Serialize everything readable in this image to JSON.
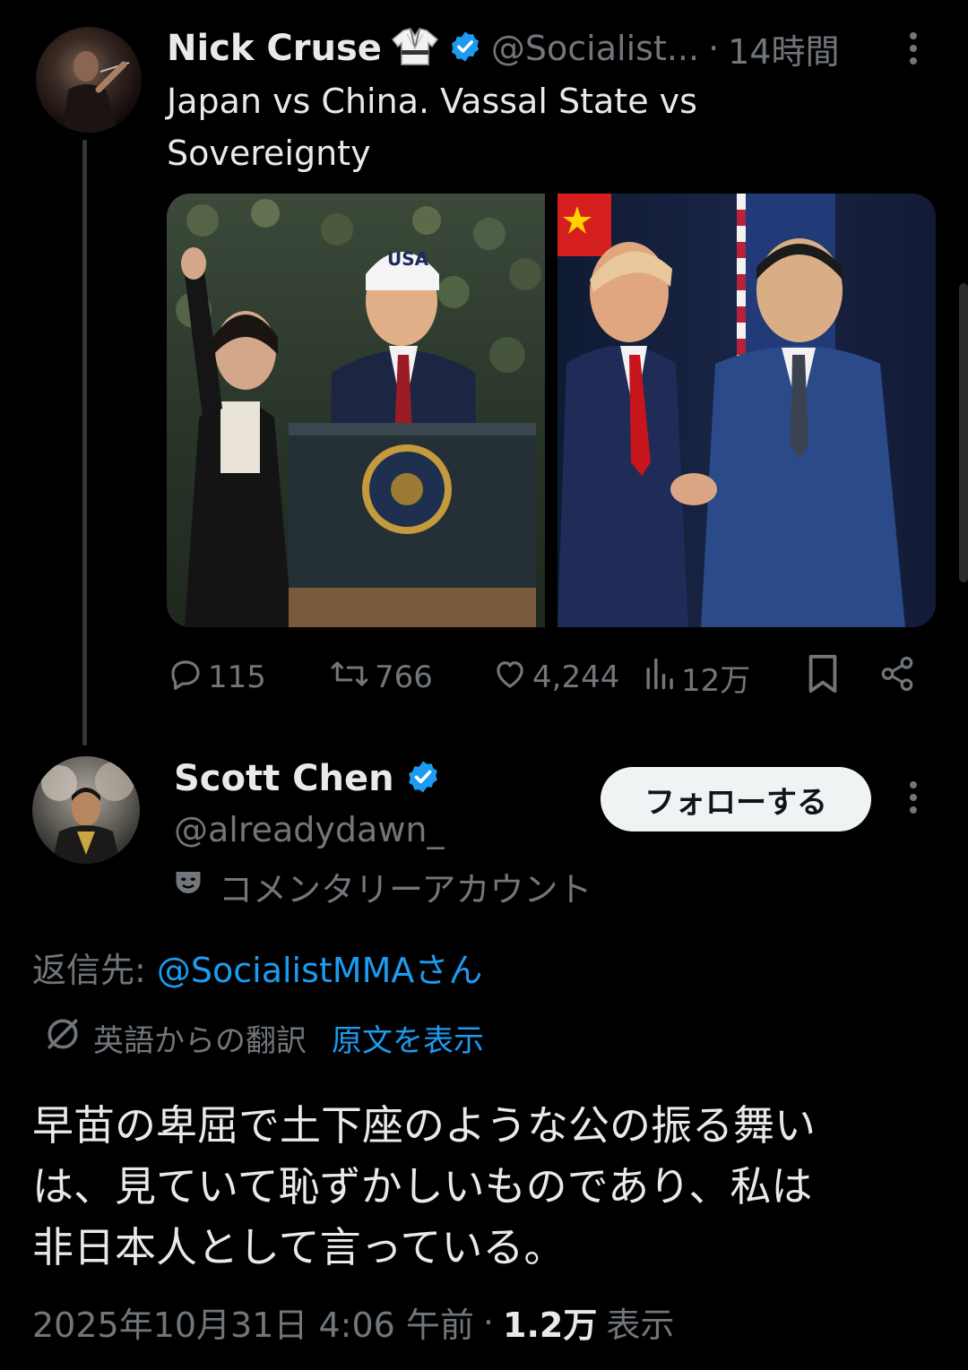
{
  "parent_tweet": {
    "author_name": "Nick Cruse",
    "handle": "@Socialist...",
    "time_separator": "·",
    "time": "14時間",
    "text_line1": "Japan vs China. Vassal State vs",
    "text_line2": "Sovereignty",
    "icons": {
      "name_badge": "gi-uniform-icon",
      "verified": "verified-badge-icon",
      "more": "more-options-icon"
    },
    "actions": {
      "replies": "115",
      "retweets": "766",
      "likes": "4,244",
      "views": "12万"
    },
    "media": [
      {
        "name": "left-photo",
        "usa_cap": "USA"
      },
      {
        "name": "right-photo"
      }
    ]
  },
  "reply": {
    "author_name": "Scott Chen",
    "handle": "@alreadydawn_",
    "commentary_label": "コメンタリーアカウント",
    "follow_button": "フォローする",
    "reply_to_prefix": "返信先: ",
    "reply_to_handle": "@SocialistMMAさん",
    "translation_label": "英語からの翻訳",
    "show_original": "原文を表示",
    "text_line1": "早苗の卑屈で土下座のような公の振る舞い",
    "text_line2": "は、見ていて恥ずかしいものであり、私は",
    "text_line3": "非日本人として言っている。",
    "timestamp": "2025年10月31日 4:06 午前",
    "meta_separator": "·",
    "view_count": "1.2万",
    "view_label": "表示"
  },
  "colors": {
    "background": "#000000",
    "text": "#e7e9ea",
    "secondary": "#71767b",
    "link": "#1d9bf0",
    "verified": "#1d9bf0"
  }
}
